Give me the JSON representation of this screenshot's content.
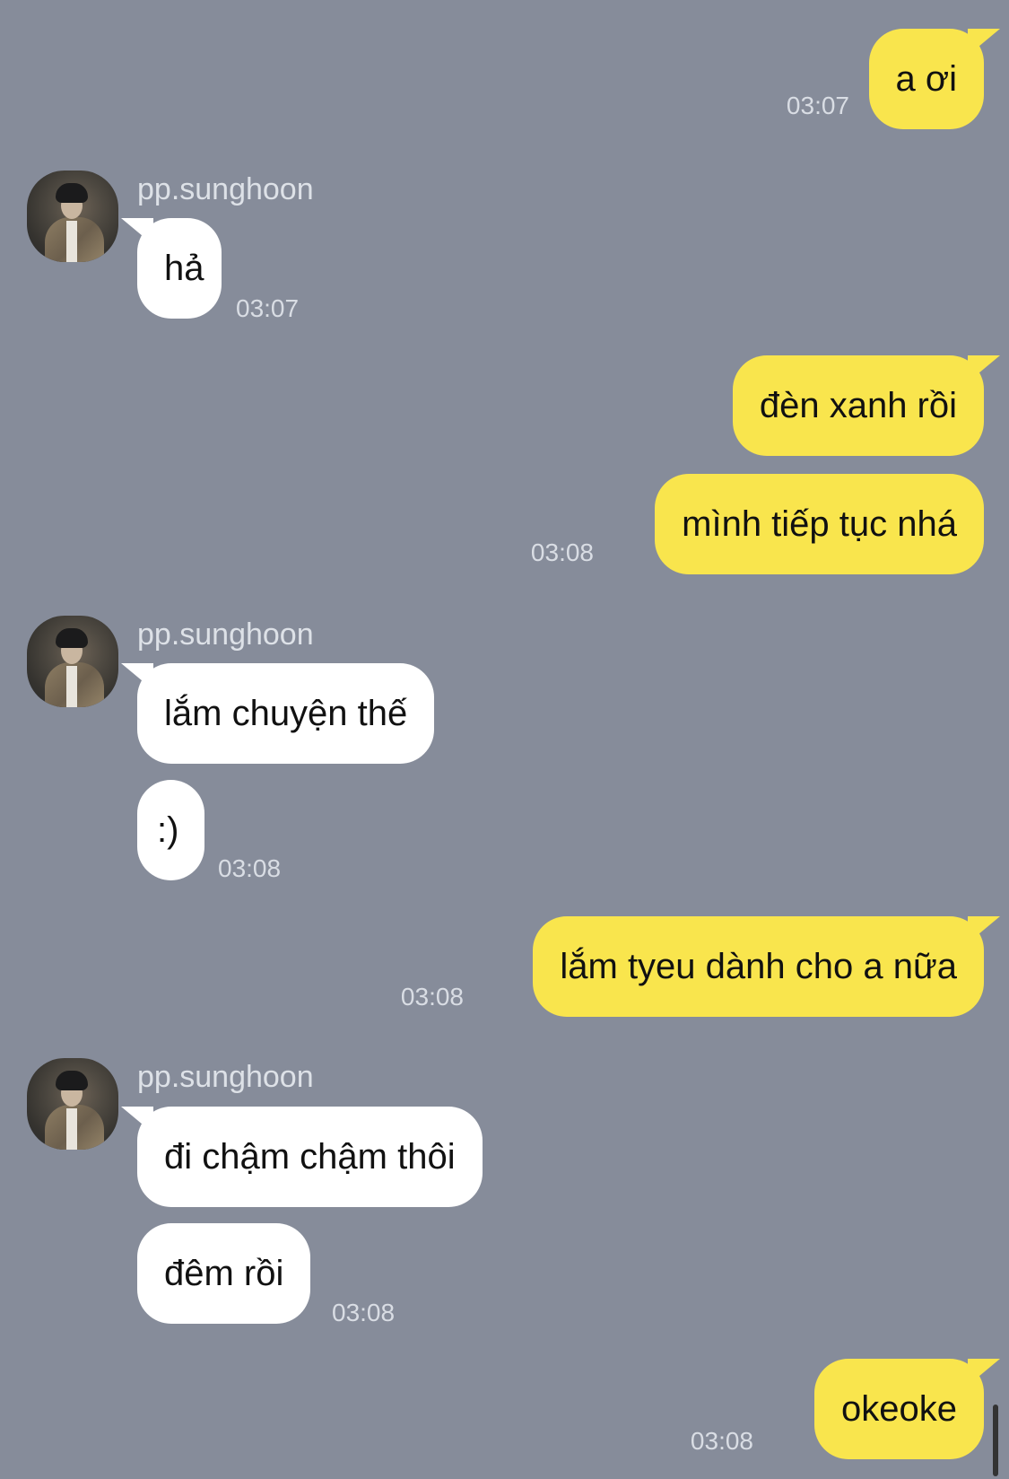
{
  "sender_name": "pp.sunghoon",
  "messages": [
    {
      "text": "a ơi",
      "time": "03:07"
    },
    {
      "text": "hả",
      "time": "03:07"
    },
    {
      "text": "đèn xanh rồi"
    },
    {
      "text": "mình tiếp tục nhá",
      "time": "03:08"
    },
    {
      "text": "lắm chuyện thế"
    },
    {
      "text": ":)",
      "time": "03:08"
    },
    {
      "text": "lắm tyeu dành cho a nữa",
      "time": "03:08"
    },
    {
      "text": "đi chậm chậm thôi"
    },
    {
      "text": "đêm rồi",
      "time": "03:08"
    },
    {
      "text": "okeoke",
      "time": "03:08"
    }
  ],
  "colors": {
    "background": "#868c9a",
    "my_bubble": "#f9e54d",
    "their_bubble": "#ffffff",
    "timestamp": "#d9dde4"
  }
}
